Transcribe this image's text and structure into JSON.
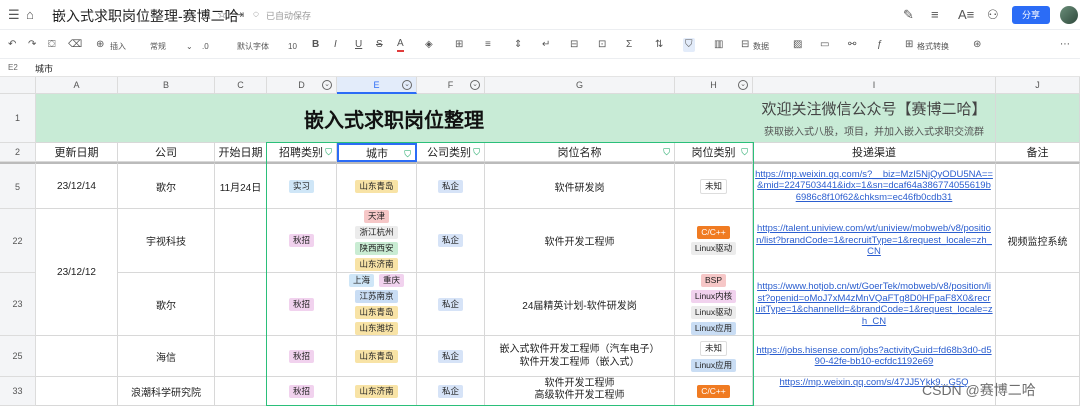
{
  "app": {
    "doc_title": "嵌入式求职岗位整理-赛博二哈",
    "autosave": "已自动保存",
    "share": "分享"
  },
  "toolbar": {
    "insert": "插入",
    "format_style": "常规",
    "decimal": ".0",
    "font": "默认字体",
    "font_size": "10",
    "data": "数据",
    "format_convert": "格式转换"
  },
  "formula_bar": {
    "cell_ref": "E2",
    "value": "城市"
  },
  "columns": [
    "A",
    "B",
    "C",
    "D",
    "E",
    "F",
    "G",
    "H",
    "I",
    "J"
  ],
  "rows": [
    "1",
    "2",
    "5",
    "22",
    "23",
    "25",
    "33"
  ],
  "sheet": {
    "title": "嵌入式求职岗位整理",
    "wechat_title": "欢迎关注微信公众号【赛博二哈】",
    "wechat_sub": "获取嵌入式八股，项目，并加入嵌入式求职交流群",
    "headers": [
      "更新日期",
      "公司",
      "开始日期",
      "招聘类别",
      "城市",
      "公司类别",
      "岗位名称",
      "岗位类别",
      "投递渠道",
      "备注"
    ],
    "r5": {
      "date": "23/12/14",
      "company": "歌尔",
      "start": "11月24日",
      "type": "实习",
      "city": "山东青岛",
      "ctype": "私企",
      "job": "软件研发岗",
      "cat": "未知",
      "link": "https://mp.weixin.qq.com/s?__biz=MzI5NjQyODU5NA==&mid=2247503441&idx=1&sn=dcaf64a386774055619b6986c8f10f62&chksm=ec46fb0cdb31"
    },
    "r22": {
      "company": "宇视科技",
      "type": "秋招",
      "cities": [
        "天津",
        "浙江杭州",
        "陕西西安",
        "山东济南"
      ],
      "ctype": "私企",
      "job": "软件开发工程师",
      "cats": [
        "C/C++",
        "Linux驱动"
      ],
      "link": "https://talent.uniview.com/wt/uniview/mobweb/v8/position/list?brandCode=1&recruitType=1&request_locale=zh_CN",
      "note": "视频监控系统"
    },
    "merged_date_22_23": "23/12/12",
    "r23": {
      "company": "歌尔",
      "type": "秋招",
      "cities_row1": [
        "上海",
        "重庆"
      ],
      "cities": [
        "江苏南京",
        "山东青岛",
        "山东潍坊"
      ],
      "ctype": "私企",
      "job": "24届精英计划-软件研发岗",
      "cats": [
        "BSP",
        "Linux内核",
        "Linux驱动",
        "Linux应用"
      ],
      "link": "https://www.hotjob.cn/wt/GoerTek/mobweb/v8/position/list?openid=oMoJ7xM4zMnVQaFTg8D0HFpaF8X0&recruitType=1&channelId=&brandCode=1&request_locale=zh_CN"
    },
    "r25": {
      "company": "海信",
      "type": "秋招",
      "city": "山东青岛",
      "ctype": "私企",
      "job_line1": "嵌入式软件开发工程师（汽车电子）",
      "job_line2": "软件开发工程师（嵌入式）",
      "cats": [
        "未知",
        "Linux应用"
      ],
      "link": "https://jobs.hisense.com/jobs?activityGuid=fd68b3d0-d590-42fe-bb10-ecfdc1192e69"
    },
    "r33": {
      "company": "浪潮科学研究院",
      "type": "秋招",
      "city": "山东济南",
      "ctype": "私企",
      "job_line1": "软件开发工程师",
      "job_line2": "高级软件开发工程师",
      "cats": [
        "C/C++"
      ],
      "link": "https://mp.weixin.qq.com/s/47JJ5Ykk9...G5Q"
    }
  },
  "watermark": "CSDN @赛博二哈",
  "colors": {
    "title_bg": "#c8ebd6",
    "accent_blue": "#2b6cf6",
    "filter_green": "#0aa05a",
    "tag_intern": "#cfe6f7",
    "tag_autumn": "#f1d2ee",
    "tag_qingdao": "#f8e3a6",
    "tag_private": "#d6e3f7",
    "tag_cpp": "#f07b22",
    "tag_linux_driver": "#ececec",
    "tag_tianjin": "#f6c7c7",
    "tag_hangzhou": "#ececec",
    "tag_xian": "#c9ecd3",
    "tag_jinan": "#f8e3a6",
    "tag_bsp": "#f6c7c7",
    "tag_kernel": "#f1d2ee",
    "tag_linux_app": "#c9ddf4"
  }
}
